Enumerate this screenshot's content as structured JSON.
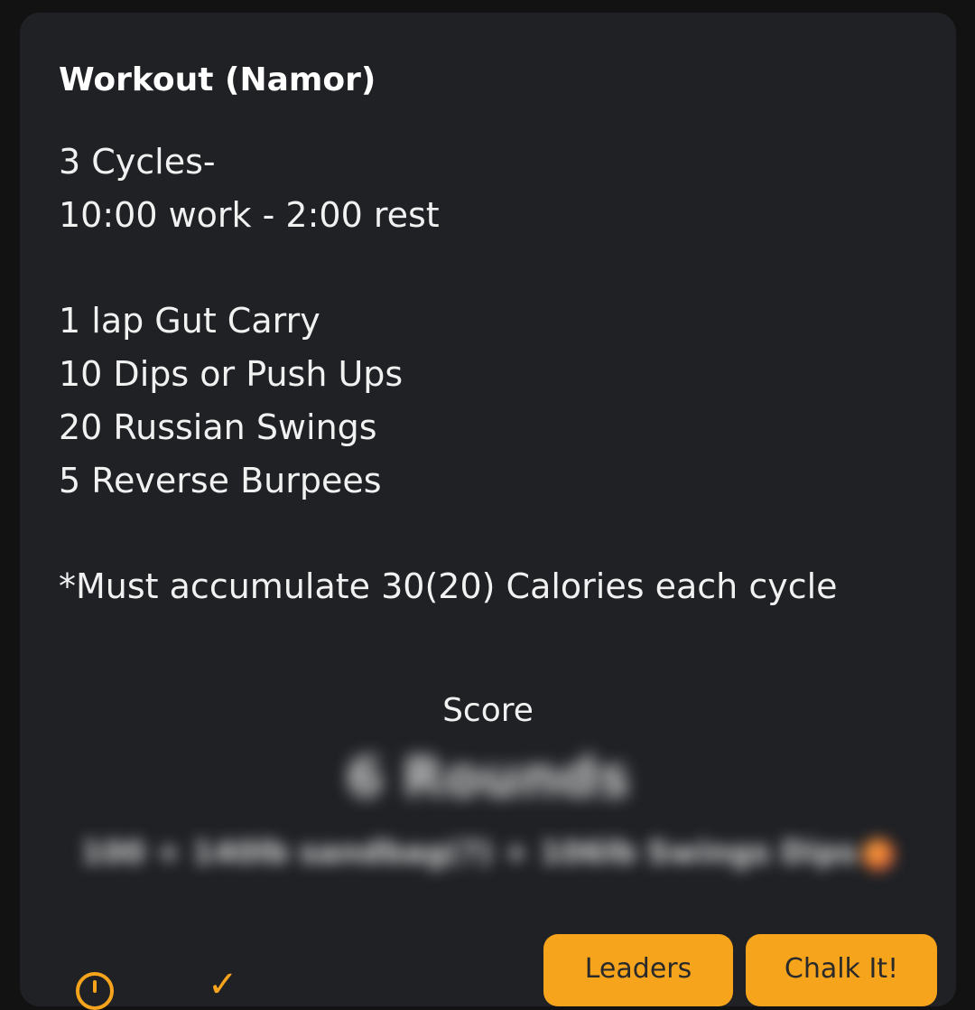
{
  "workout": {
    "title": "Workout (Namor)",
    "description_lines": [
      "3 Cycles-",
      "10:00 work - 2:00 rest",
      "",
      "1 lap Gut Carry",
      "10 Dips or Push Ups",
      "20 Russian Swings",
      "5 Reverse Burpees",
      "",
      "*Must accumulate 30(20) Calories each cycle"
    ]
  },
  "score": {
    "label": "Score",
    "value": "6 Rounds",
    "notes": "100 + 140lb sandbag(?) + 106lb Swings Dips"
  },
  "actions": {
    "leaders_label": "Leaders",
    "chalk_label": "Chalk It!"
  },
  "colors": {
    "background": "#121212",
    "card": "#1f2125",
    "accent": "#f7a41d",
    "text": "#f1f1f1"
  },
  "icons": {
    "timer": "timer-icon",
    "check": "check-icon"
  }
}
